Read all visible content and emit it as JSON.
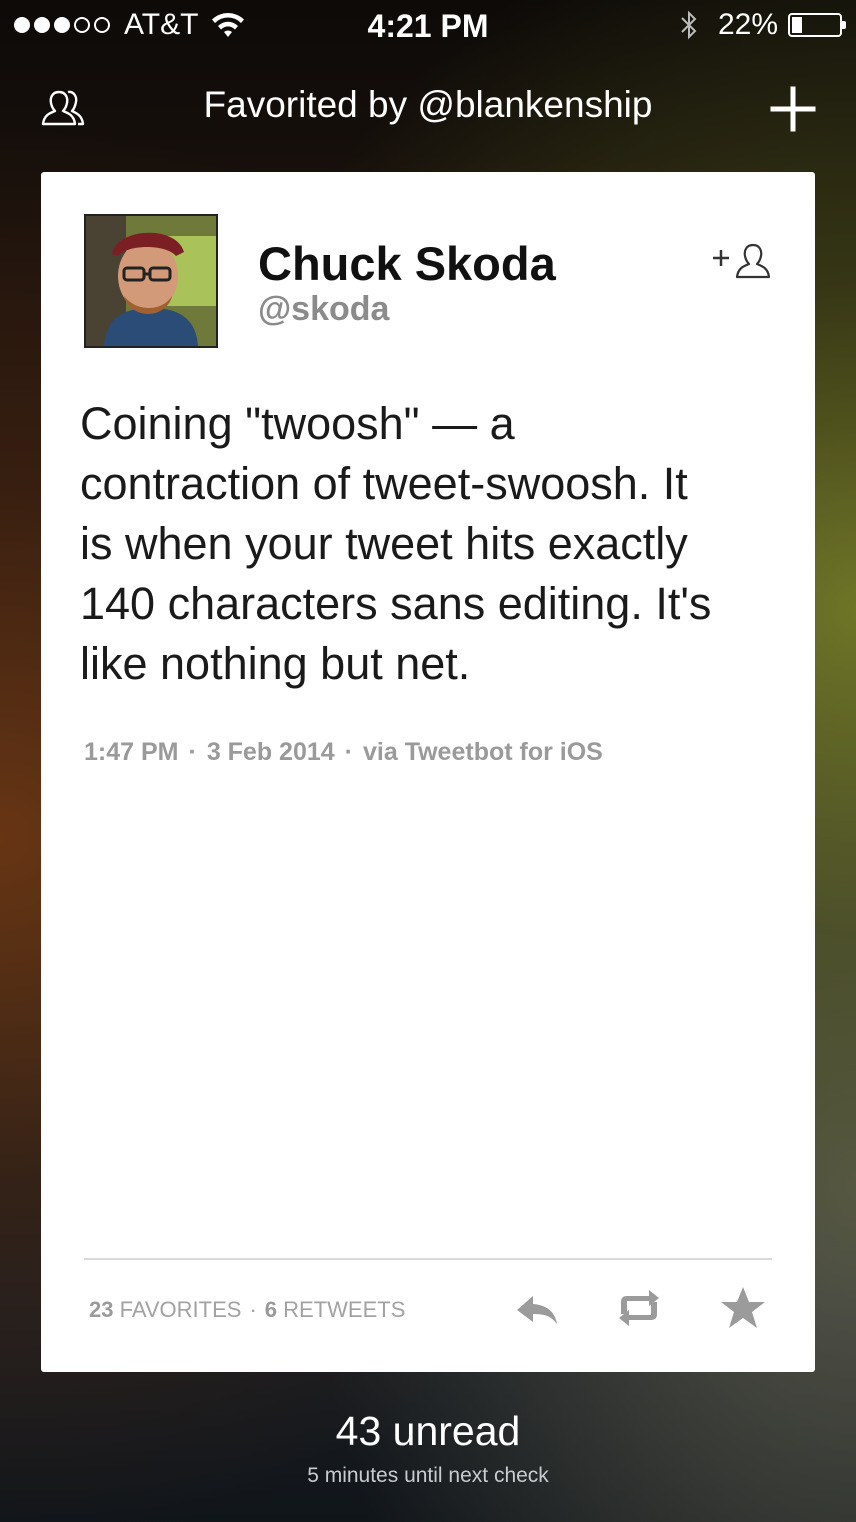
{
  "status_bar": {
    "carrier": "AT&T",
    "time": "4:21 PM",
    "battery": "22%",
    "battery_level": 0.22,
    "signal_bars_filled": 3,
    "signal_bars_total": 5
  },
  "nav": {
    "title": "Favorited by @blankenship",
    "left_icon": "people-icon",
    "right_icon": "plus-icon"
  },
  "tweet": {
    "author_name": "Chuck Skoda",
    "author_handle": "@skoda",
    "text": "Coining \"twoosh\" — a\ncontraction of tweet-swoosh. It\nis when your tweet hits exactly\n140 characters sans editing. It's\nlike nothing but net.",
    "time": "1:47 PM",
    "date": "3 Feb 2014",
    "via": "via Tweetbot for iOS",
    "separator": "·",
    "favorites_count": "23",
    "favorites_label": "FAVORITES",
    "retweets_count": "6",
    "retweets_label": "RETWEETS"
  },
  "footer": {
    "unread": "43 unread",
    "next_check": "5 minutes until next check"
  },
  "colors": {
    "card_bg": "#ffffff",
    "meta_gray": "#9a9a9a",
    "icon_gray": "#9b9b9b"
  }
}
